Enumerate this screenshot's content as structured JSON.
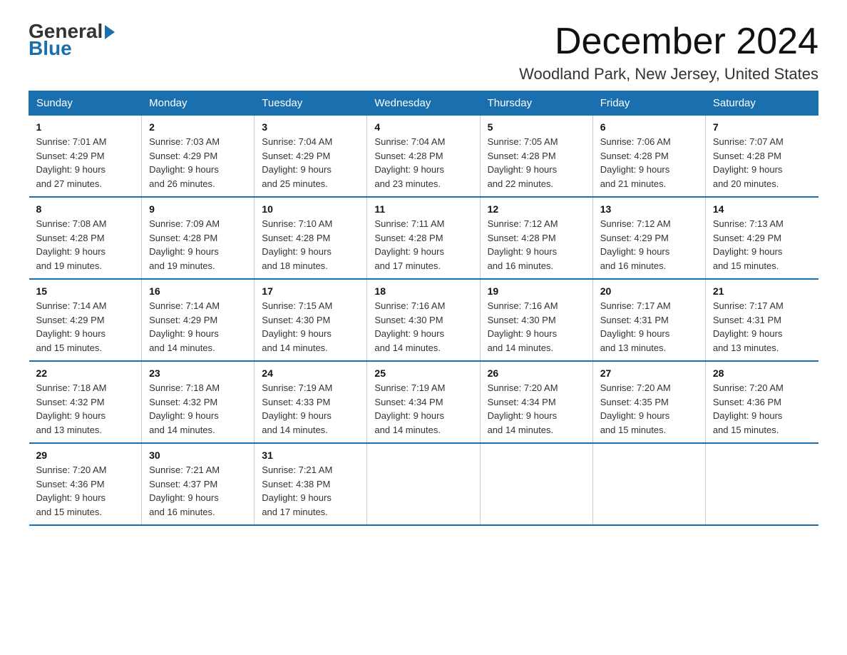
{
  "logo": {
    "general": "General",
    "blue": "Blue"
  },
  "title": "December 2024",
  "subtitle": "Woodland Park, New Jersey, United States",
  "weekdays": [
    "Sunday",
    "Monday",
    "Tuesday",
    "Wednesday",
    "Thursday",
    "Friday",
    "Saturday"
  ],
  "weeks": [
    [
      {
        "day": "1",
        "sunrise": "7:01 AM",
        "sunset": "4:29 PM",
        "daylight": "9 hours and 27 minutes."
      },
      {
        "day": "2",
        "sunrise": "7:03 AM",
        "sunset": "4:29 PM",
        "daylight": "9 hours and 26 minutes."
      },
      {
        "day": "3",
        "sunrise": "7:04 AM",
        "sunset": "4:29 PM",
        "daylight": "9 hours and 25 minutes."
      },
      {
        "day": "4",
        "sunrise": "7:04 AM",
        "sunset": "4:28 PM",
        "daylight": "9 hours and 23 minutes."
      },
      {
        "day": "5",
        "sunrise": "7:05 AM",
        "sunset": "4:28 PM",
        "daylight": "9 hours and 22 minutes."
      },
      {
        "day": "6",
        "sunrise": "7:06 AM",
        "sunset": "4:28 PM",
        "daylight": "9 hours and 21 minutes."
      },
      {
        "day": "7",
        "sunrise": "7:07 AM",
        "sunset": "4:28 PM",
        "daylight": "9 hours and 20 minutes."
      }
    ],
    [
      {
        "day": "8",
        "sunrise": "7:08 AM",
        "sunset": "4:28 PM",
        "daylight": "9 hours and 19 minutes."
      },
      {
        "day": "9",
        "sunrise": "7:09 AM",
        "sunset": "4:28 PM",
        "daylight": "9 hours and 19 minutes."
      },
      {
        "day": "10",
        "sunrise": "7:10 AM",
        "sunset": "4:28 PM",
        "daylight": "9 hours and 18 minutes."
      },
      {
        "day": "11",
        "sunrise": "7:11 AM",
        "sunset": "4:28 PM",
        "daylight": "9 hours and 17 minutes."
      },
      {
        "day": "12",
        "sunrise": "7:12 AM",
        "sunset": "4:28 PM",
        "daylight": "9 hours and 16 minutes."
      },
      {
        "day": "13",
        "sunrise": "7:12 AM",
        "sunset": "4:29 PM",
        "daylight": "9 hours and 16 minutes."
      },
      {
        "day": "14",
        "sunrise": "7:13 AM",
        "sunset": "4:29 PM",
        "daylight": "9 hours and 15 minutes."
      }
    ],
    [
      {
        "day": "15",
        "sunrise": "7:14 AM",
        "sunset": "4:29 PM",
        "daylight": "9 hours and 15 minutes."
      },
      {
        "day": "16",
        "sunrise": "7:14 AM",
        "sunset": "4:29 PM",
        "daylight": "9 hours and 14 minutes."
      },
      {
        "day": "17",
        "sunrise": "7:15 AM",
        "sunset": "4:30 PM",
        "daylight": "9 hours and 14 minutes."
      },
      {
        "day": "18",
        "sunrise": "7:16 AM",
        "sunset": "4:30 PM",
        "daylight": "9 hours and 14 minutes."
      },
      {
        "day": "19",
        "sunrise": "7:16 AM",
        "sunset": "4:30 PM",
        "daylight": "9 hours and 14 minutes."
      },
      {
        "day": "20",
        "sunrise": "7:17 AM",
        "sunset": "4:31 PM",
        "daylight": "9 hours and 13 minutes."
      },
      {
        "day": "21",
        "sunrise": "7:17 AM",
        "sunset": "4:31 PM",
        "daylight": "9 hours and 13 minutes."
      }
    ],
    [
      {
        "day": "22",
        "sunrise": "7:18 AM",
        "sunset": "4:32 PM",
        "daylight": "9 hours and 13 minutes."
      },
      {
        "day": "23",
        "sunrise": "7:18 AM",
        "sunset": "4:32 PM",
        "daylight": "9 hours and 14 minutes."
      },
      {
        "day": "24",
        "sunrise": "7:19 AM",
        "sunset": "4:33 PM",
        "daylight": "9 hours and 14 minutes."
      },
      {
        "day": "25",
        "sunrise": "7:19 AM",
        "sunset": "4:34 PM",
        "daylight": "9 hours and 14 minutes."
      },
      {
        "day": "26",
        "sunrise": "7:20 AM",
        "sunset": "4:34 PM",
        "daylight": "9 hours and 14 minutes."
      },
      {
        "day": "27",
        "sunrise": "7:20 AM",
        "sunset": "4:35 PM",
        "daylight": "9 hours and 15 minutes."
      },
      {
        "day": "28",
        "sunrise": "7:20 AM",
        "sunset": "4:36 PM",
        "daylight": "9 hours and 15 minutes."
      }
    ],
    [
      {
        "day": "29",
        "sunrise": "7:20 AM",
        "sunset": "4:36 PM",
        "daylight": "9 hours and 15 minutes."
      },
      {
        "day": "30",
        "sunrise": "7:21 AM",
        "sunset": "4:37 PM",
        "daylight": "9 hours and 16 minutes."
      },
      {
        "day": "31",
        "sunrise": "7:21 AM",
        "sunset": "4:38 PM",
        "daylight": "9 hours and 17 minutes."
      },
      null,
      null,
      null,
      null
    ]
  ]
}
